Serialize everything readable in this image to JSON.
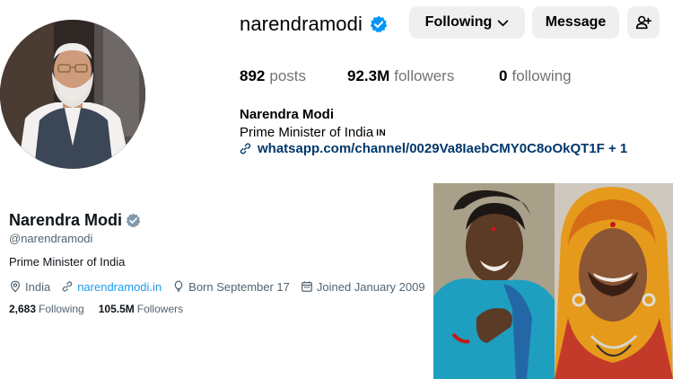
{
  "instagram": {
    "username": "narendramodi",
    "buttons": {
      "following": "Following",
      "message": "Message"
    },
    "stats": {
      "posts_count": "892",
      "posts_label": "posts",
      "followers_count": "92.3M",
      "followers_label": "followers",
      "following_count": "0",
      "following_label": "following"
    },
    "full_name": "Narendra Modi",
    "bio": "Prime Minister of India",
    "bio_flag": "IN",
    "link": "whatsapp.com/channel/0029Va8IaebCMY0C8oOkQT1F + 1",
    "icons": [
      "verified-badge-icon",
      "chevron-down-icon",
      "add-user-icon",
      "link-icon"
    ],
    "colors": {
      "verified": "#0095f6",
      "link": "#00376b",
      "button_bg": "#efefef"
    }
  },
  "x": {
    "name": "Narendra Modi",
    "handle": "@narendramodi",
    "bio": "Prime Minister of India",
    "location": "India",
    "website": "narendramodi.in",
    "birthday": "Born September 17",
    "joined": "Joined January 2009",
    "following_count": "2,683",
    "following_label": "Following",
    "followers_count": "105.5M",
    "followers_label": "Followers",
    "icons": [
      "verified-gray-icon",
      "location-icon",
      "link-icon",
      "balloon-icon",
      "calendar-icon"
    ],
    "colors": {
      "link": "#1d9bf0",
      "muted": "#536471"
    }
  }
}
